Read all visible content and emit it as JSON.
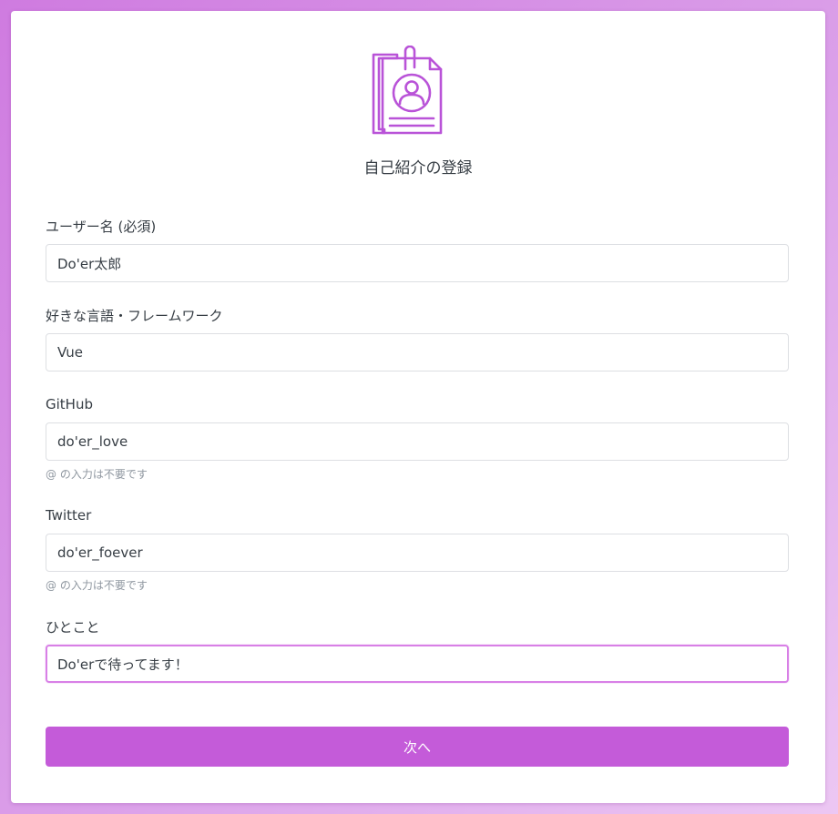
{
  "form": {
    "title": "自己紹介の登録",
    "username": {
      "label": "ユーザー名 (必須)",
      "value": "Do'er太郎"
    },
    "favorite": {
      "label": "好きな言語・フレームワーク",
      "value": "Vue"
    },
    "github": {
      "label": "GitHub",
      "value": "do'er_love",
      "hint": "@ の入力は不要です"
    },
    "twitter": {
      "label": "Twitter",
      "value": "do'er_foever",
      "hint": "@ の入力は不要です"
    },
    "comment": {
      "label": "ひとこと",
      "value": "Do'erで待ってます！"
    },
    "next_label": "次へ"
  },
  "colors": {
    "accent": "#c45bd9",
    "focus_border": "#d880e6",
    "icon_stroke": "#b953d8",
    "background_top": "#cf7be0",
    "background_bottom": "#ecc7f3"
  },
  "icons": {
    "logo": "profile-document-icon"
  }
}
